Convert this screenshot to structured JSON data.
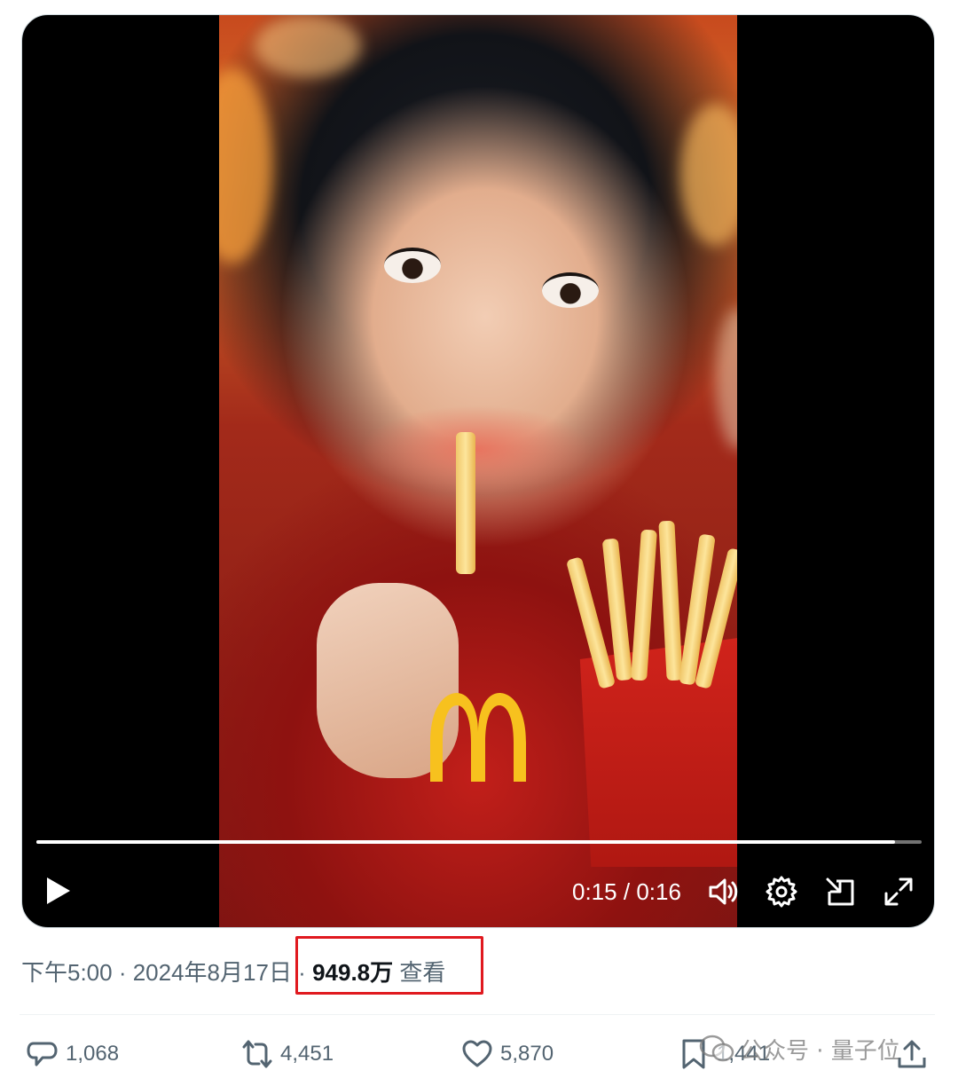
{
  "player": {
    "current_time": "0:15",
    "separator": "/",
    "duration": "0:16",
    "progress": 0.97
  },
  "post_meta": {
    "time": "下午5:00",
    "dot1": " · ",
    "date": "2024年8月17日",
    "dot2": " · ",
    "views_number": "949.8万",
    "views_label": " 查看"
  },
  "actions": {
    "replies": "1,068",
    "reposts": "4,451",
    "likes": "5,870",
    "bookmarks": "1,441"
  },
  "watermark": {
    "text": "公众号 · 量子位"
  },
  "colors": {
    "highlight": "#e0191f",
    "muted_text": "#536471",
    "strong_text": "#0f1419",
    "arches": "#f7c11e"
  }
}
